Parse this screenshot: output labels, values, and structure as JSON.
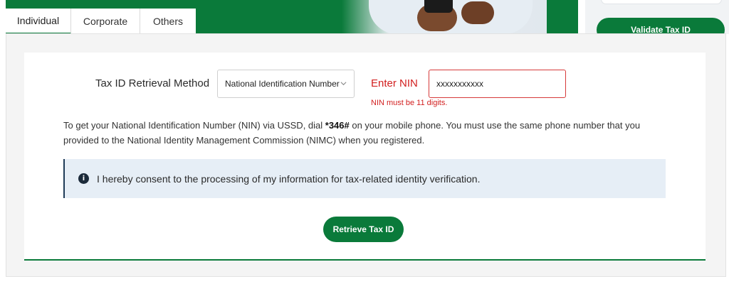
{
  "tabs": [
    {
      "label": "Individual",
      "active": true
    },
    {
      "label": "Corporate",
      "active": false
    },
    {
      "label": "Others",
      "active": false
    }
  ],
  "sidebar": {
    "validate_button": "Validate Tax ID"
  },
  "form": {
    "method_label": "Tax ID Retrieval Method",
    "method_selected": "National Identification Number",
    "nin_label": "Enter NIN",
    "nin_value": "xxxxxxxxxxx",
    "nin_error": "NIN must be 11 digits."
  },
  "info": {
    "text_before": "To get your National Identification Number (NIN) via USSD, dial ",
    "ussd_code": "*346#",
    "text_after": " on your mobile phone. You must use the same phone number that you provided to the National Identity Management Commission (NIMC) when you registered."
  },
  "consent": {
    "icon": "info-icon",
    "text": "I hereby consent to the processing of my information for tax-related identity verification."
  },
  "actions": {
    "retrieve_button": "Retrieve Tax ID"
  },
  "colors": {
    "brand_green": "#0a7a3a",
    "error_red": "#d21f1f",
    "consent_bg": "#e6eef6"
  }
}
